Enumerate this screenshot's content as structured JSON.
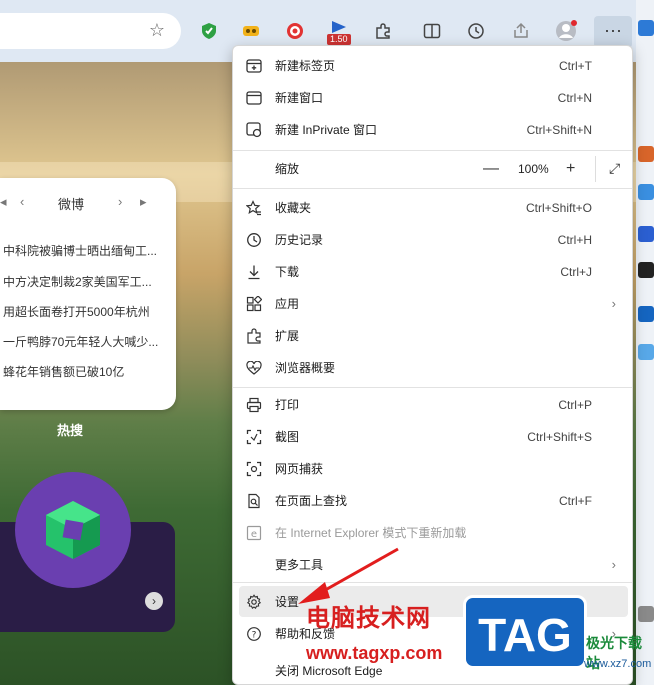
{
  "toolbar": {
    "more_label": "···",
    "badge_text": "1.50",
    "star_glyph": "☆"
  },
  "background_page": {
    "hot_card": {
      "title": "微博",
      "items": [
        "中科院被骗博士晒出缅甸工...",
        "中方决定制裁2家美国军工...",
        "用超长面卷打开5000年杭州",
        "一斤鸭脖70元年轻人大喊少...",
        "蜂花年销售额已破10亿"
      ]
    },
    "hot_label": "热搜"
  },
  "menu": {
    "new_tab": {
      "label": "新建标签页",
      "shortcut": "Ctrl+T"
    },
    "new_window": {
      "label": "新建窗口",
      "shortcut": "Ctrl+N"
    },
    "new_inprivate": {
      "label": "新建 InPrivate 窗口",
      "shortcut": "Ctrl+Shift+N"
    },
    "zoom": {
      "label": "缩放",
      "minus": "—",
      "value": "100%",
      "plus": "+",
      "fullscreen": "⤢"
    },
    "favorites": {
      "label": "收藏夹",
      "shortcut": "Ctrl+Shift+O"
    },
    "history": {
      "label": "历史记录",
      "shortcut": "Ctrl+H"
    },
    "downloads": {
      "label": "下载",
      "shortcut": "Ctrl+J"
    },
    "apps": {
      "label": "应用"
    },
    "extensions": {
      "label": "扩展"
    },
    "browser_essentials": {
      "label": "浏览器概要"
    },
    "print": {
      "label": "打印",
      "shortcut": "Ctrl+P"
    },
    "screenshot": {
      "label": "截图",
      "shortcut": "Ctrl+Shift+S"
    },
    "web_capture": {
      "label": "网页捕获"
    },
    "find": {
      "label": "在页面上查找",
      "shortcut": "Ctrl+F"
    },
    "ie_mode": {
      "label": "在 Internet Explorer 模式下重新加载"
    },
    "more_tools": {
      "label": "更多工具"
    },
    "settings": {
      "label": "设置"
    },
    "help": {
      "label": "帮助和反馈"
    },
    "close_edge": {
      "label": "关闭 Microsoft Edge"
    }
  },
  "watermark": {
    "site_name": "电脑技术网",
    "site_url": "www.tagxp.com",
    "logo_text": "TAG",
    "xz_name": "极光下载站",
    "xz_url": "www.xz7.com"
  },
  "colors": {
    "accent_red": "#d71f1f",
    "menu_bg": "#ffffff",
    "toolbar_bg": "#dfe8f3"
  }
}
